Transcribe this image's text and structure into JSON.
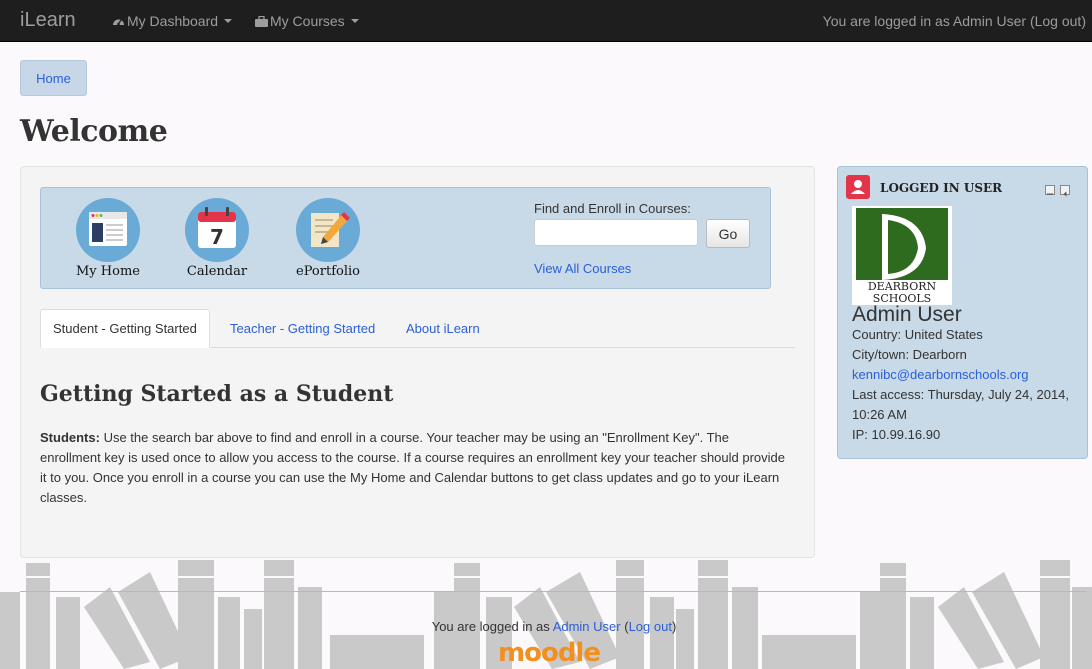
{
  "navbar": {
    "brand": "iLearn",
    "menu": [
      {
        "label": "My Dashboard",
        "icon": "dashboard-icon"
      },
      {
        "label": "My Courses",
        "icon": "briefcase-icon"
      }
    ],
    "login_text": "You are logged in as Admin User (Log out)"
  },
  "breadcrumb": {
    "home": "Home"
  },
  "page_title": "Welcome",
  "quick_links": [
    {
      "label": "My Home",
      "icon": "home-browser-icon"
    },
    {
      "label": "Calendar",
      "icon": "calendar-icon",
      "day": "7"
    },
    {
      "label": "ePortfolio",
      "icon": "pencil-paper-icon"
    }
  ],
  "find_courses": {
    "label": "Find and Enroll in Courses:",
    "input_value": "",
    "go_label": "Go",
    "view_all": "View All Courses"
  },
  "tabs": [
    {
      "label": "Student - Getting Started",
      "active": true
    },
    {
      "label": "Teacher - Getting Started",
      "active": false
    },
    {
      "label": "About iLearn",
      "active": false
    }
  ],
  "section": {
    "title": "Getting Started as a Student",
    "lead": "Students:",
    "body": " Use the search bar above to find and enroll in a course. Your teacher may be using an \"Enrollment Key\". The enrollment key is used once to allow you access to the course. If a course requires an enrollment key your teacher should provide it to you. Once you enroll in a course you can use the My Home and Calendar buttons to get class updates and go to your iLearn classes."
  },
  "user_block": {
    "title": "LOGGED IN USER",
    "logo_text_1": "DEARBORN",
    "logo_text_2": "SCHOOLS",
    "name": "Admin User",
    "country": "Country: United States",
    "city": "City/town: Dearborn",
    "email": "kennibc@dearbornschools.org",
    "last_access": "Last access: Thursday, July 24, 2014, 10:26 AM",
    "ip": "IP: 10.99.16.90"
  },
  "footer": {
    "prefix": "You are logged in as ",
    "user_link": "Admin User",
    "open_paren": " (",
    "logout": "Log out",
    "close_paren": ")",
    "logo": "moodle"
  },
  "colors": {
    "navbar": "#1e1e1e",
    "panel_blue": "#c8d9e7",
    "link": "#2a5fd8",
    "block_icon": "#e4344a",
    "moodle_orange": "#f28f1f"
  }
}
